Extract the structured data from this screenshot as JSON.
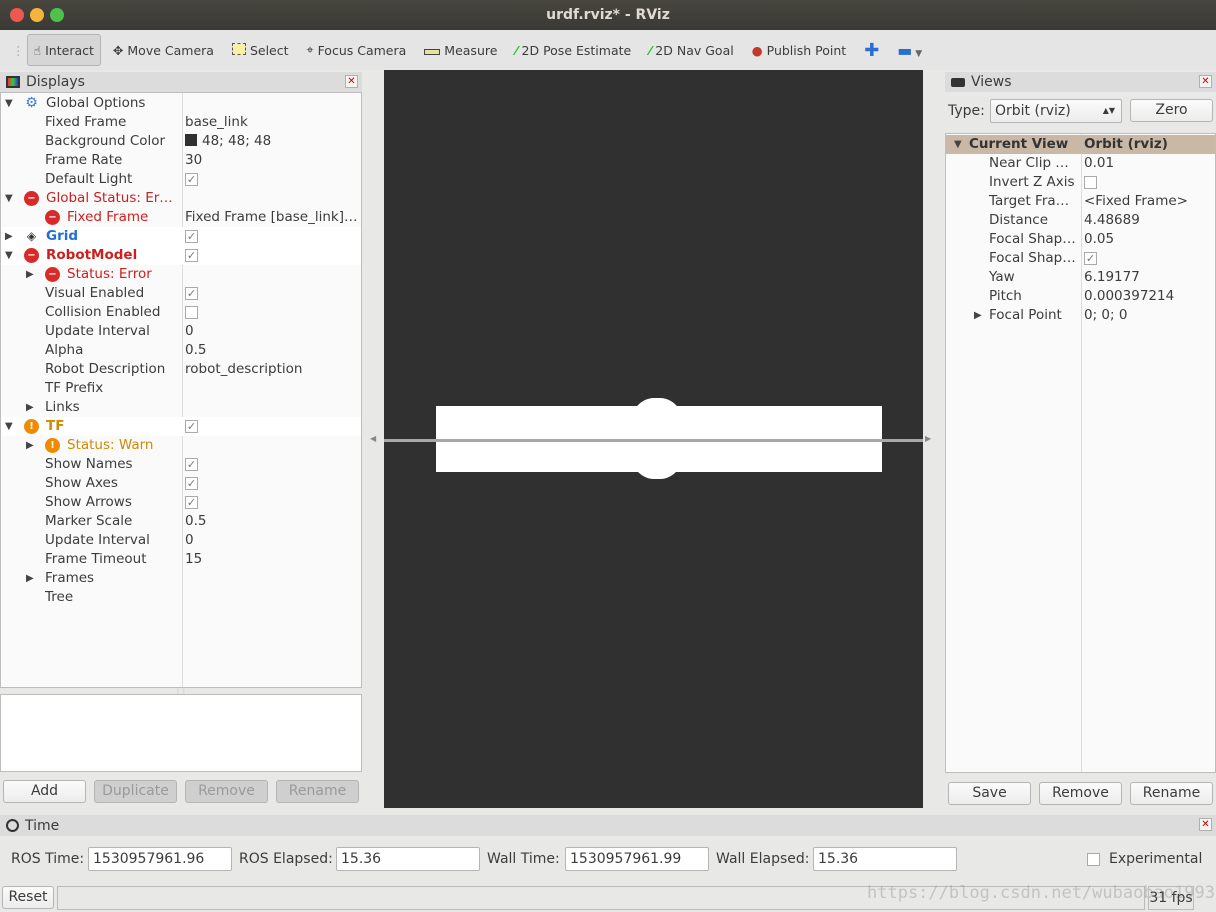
{
  "window": {
    "title": "urdf.rviz* - RViz"
  },
  "toolbar": [
    {
      "label": "Interact",
      "icon": "hand-icon",
      "active": true
    },
    {
      "label": "Move Camera",
      "icon": "move-camera-icon"
    },
    {
      "label": "Select",
      "icon": "select-icon"
    },
    {
      "label": "Focus Camera",
      "icon": "focus-camera-icon"
    },
    {
      "label": "Measure",
      "icon": "ruler-icon"
    },
    {
      "label": "2D Pose Estimate",
      "icon": "green-arrow-icon"
    },
    {
      "label": "2D Nav Goal",
      "icon": "green-arrow-icon"
    },
    {
      "label": "Publish Point",
      "icon": "map-pin-icon"
    },
    {
      "label": "",
      "icon": "plus-icon"
    },
    {
      "label": "",
      "icon": "minus-icon"
    }
  ],
  "displays": {
    "title": "Displays",
    "rows": [
      {
        "level": 0,
        "exp": "down",
        "icon": "gear",
        "label": "Global Options",
        "value": ""
      },
      {
        "level": 1,
        "label": "Fixed Frame",
        "value": "base_link"
      },
      {
        "level": 1,
        "label": "Background Color",
        "value": "48; 48; 48",
        "swatch": "#303030"
      },
      {
        "level": 1,
        "label": "Frame Rate",
        "value": "30"
      },
      {
        "level": 1,
        "label": "Default Light",
        "check": true
      },
      {
        "level": 0,
        "exp": "down",
        "icon": "err",
        "label": "Global Status: Er…",
        "style": "red"
      },
      {
        "level": 1,
        "icon": "err",
        "label": "Fixed Frame",
        "value": "Fixed Frame [base_link]…",
        "style": "red"
      },
      {
        "level": 0,
        "exp": "right",
        "icon": "grid",
        "label": "Grid",
        "check": true,
        "style": "blue",
        "hl": true
      },
      {
        "level": 0,
        "exp": "down",
        "icon": "err",
        "label": "RobotModel",
        "check": true,
        "style": "boldred",
        "hl": true
      },
      {
        "level": 1,
        "exp": "right",
        "icon": "err",
        "label": "Status: Error",
        "style": "red"
      },
      {
        "level": 1,
        "label": "Visual Enabled",
        "check": true
      },
      {
        "level": 1,
        "label": "Collision Enabled",
        "check": false
      },
      {
        "level": 1,
        "label": "Update Interval",
        "value": "0"
      },
      {
        "level": 1,
        "label": "Alpha",
        "value": "0.5"
      },
      {
        "level": 1,
        "label": "Robot Description",
        "value": "robot_description"
      },
      {
        "level": 1,
        "label": "TF Prefix",
        "value": ""
      },
      {
        "level": 1,
        "exp": "right",
        "label": "Links",
        "value": ""
      },
      {
        "level": 0,
        "exp": "down",
        "icon": "warn",
        "label": "TF",
        "check": true,
        "style": "boldorange",
        "hl": true
      },
      {
        "level": 1,
        "exp": "right",
        "icon": "warn",
        "label": "Status: Warn",
        "style": "orange"
      },
      {
        "level": 1,
        "label": "Show Names",
        "check": true
      },
      {
        "level": 1,
        "label": "Show Axes",
        "check": true
      },
      {
        "level": 1,
        "label": "Show Arrows",
        "check": true
      },
      {
        "level": 1,
        "label": "Marker Scale",
        "value": "0.5"
      },
      {
        "level": 1,
        "label": "Update Interval",
        "value": "0"
      },
      {
        "level": 1,
        "label": "Frame Timeout",
        "value": "15"
      },
      {
        "level": 1,
        "exp": "right",
        "label": "Frames",
        "value": ""
      },
      {
        "level": 1,
        "label": "Tree",
        "value": ""
      }
    ],
    "buttons": [
      {
        "label": "Add",
        "enabled": true
      },
      {
        "label": "Duplicate",
        "enabled": false
      },
      {
        "label": "Remove",
        "enabled": false
      },
      {
        "label": "Rename",
        "enabled": false
      }
    ]
  },
  "viewport": {
    "background": "#303030"
  },
  "views": {
    "title": "Views",
    "type_label": "Type:",
    "type_value": "Orbit (rviz)",
    "zero": "Zero",
    "header": {
      "label": "Current View",
      "value": "Orbit (rviz)"
    },
    "rows": [
      {
        "label": "Near Clip …",
        "value": "0.01"
      },
      {
        "label": "Invert Z Axis",
        "check": false
      },
      {
        "label": "Target Fra…",
        "value": "<Fixed Frame>"
      },
      {
        "label": "Distance",
        "value": "4.48689"
      },
      {
        "label": "Focal Shap…",
        "value": "0.05"
      },
      {
        "label": "Focal Shap…",
        "check": true
      },
      {
        "label": "Yaw",
        "value": "6.19177"
      },
      {
        "label": "Pitch",
        "value": "0.000397214"
      },
      {
        "label": "Focal Point",
        "value": "0; 0; 0",
        "exp": "right"
      }
    ],
    "buttons": [
      "Save",
      "Remove",
      "Rename"
    ]
  },
  "time": {
    "title": "Time",
    "ros_time_label": "ROS Time:",
    "ros_time": "1530957961.96",
    "ros_elapsed_label": "ROS Elapsed:",
    "ros_elapsed": "15.36",
    "wall_time_label": "Wall Time:",
    "wall_time": "1530957961.99",
    "wall_elapsed_label": "Wall Elapsed:",
    "wall_elapsed": "15.36",
    "experimental": "Experimental"
  },
  "status": {
    "reset": "Reset",
    "fps": "31 fps",
    "watermark": "https://blog.csdn.net/wubaobao1993"
  }
}
